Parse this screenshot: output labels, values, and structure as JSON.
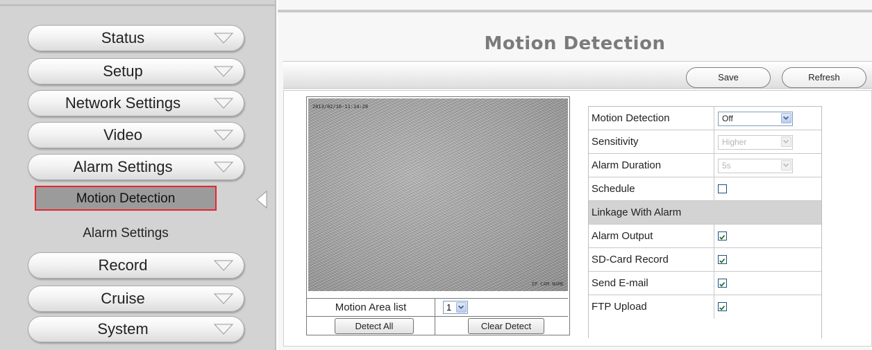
{
  "sidebar": {
    "menu": [
      {
        "label": "Status"
      },
      {
        "label": "Setup"
      },
      {
        "label": "Network Settings"
      },
      {
        "label": "Video"
      },
      {
        "label": "Alarm Settings"
      },
      {
        "label": "Record"
      },
      {
        "label": "Cruise"
      },
      {
        "label": "System"
      }
    ],
    "submenu": [
      {
        "label": "Motion Detection",
        "active": true
      },
      {
        "label": "Alarm Settings",
        "active": false
      }
    ]
  },
  "main": {
    "title": "Motion Detection",
    "toolbar": {
      "save_label": "Save",
      "refresh_label": "Refresh"
    },
    "video": {
      "timestamp": "2013/02/16-11:14:28",
      "camera_name": "IP CAM NAME"
    },
    "area_list": {
      "label": "Motion Area list",
      "value": "1"
    },
    "buttons": {
      "detect_all": "Detect All",
      "clear_detect": "Clear Detect"
    },
    "settings": {
      "motion_detection": {
        "label": "Motion Detection",
        "value": "Off"
      },
      "sensitivity": {
        "label": "Sensitivity",
        "value": "Higher"
      },
      "alarm_duration": {
        "label": "Alarm Duration",
        "value": "5s"
      },
      "schedule": {
        "label": "Schedule",
        "checked": false
      },
      "linkage_header": "Linkage With Alarm",
      "alarm_output": {
        "label": "Alarm Output",
        "checked": true
      },
      "sd_card_record": {
        "label": "SD-Card Record",
        "checked": true
      },
      "send_email": {
        "label": "Send E-mail",
        "checked": true
      },
      "ftp_upload": {
        "label": "FTP Upload",
        "checked": true
      }
    }
  },
  "colors": {
    "active_border": "#e8252c",
    "title_text": "#7b7b7b",
    "sidebar_bg": "#d3d3d3"
  }
}
